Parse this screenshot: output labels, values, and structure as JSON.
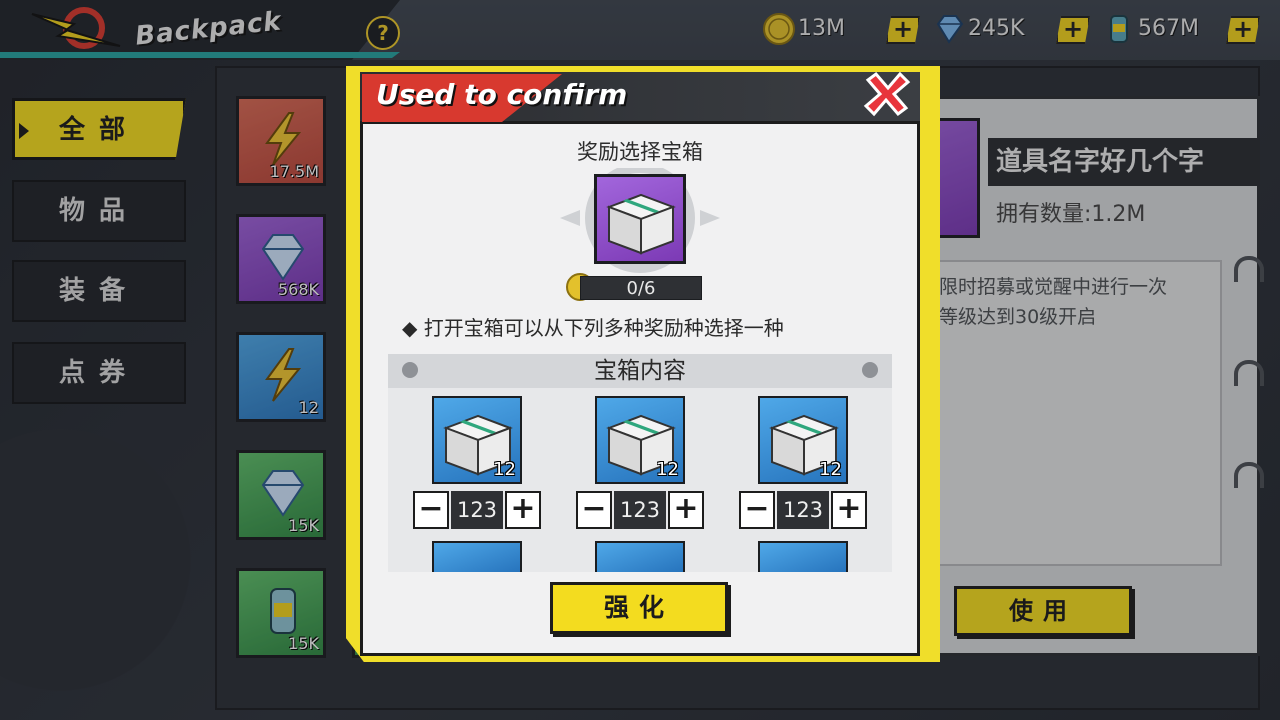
{
  "header": {
    "title": "Backpack",
    "help_label": "?"
  },
  "currencies": [
    {
      "icon": "gold-coin-icon",
      "value": "13M",
      "plus": "+"
    },
    {
      "icon": "diamond-icon",
      "value": "245K",
      "plus": "+"
    },
    {
      "icon": "canister-icon",
      "value": "567M",
      "plus": "+"
    }
  ],
  "tabs": [
    {
      "label": "全部",
      "active": true
    },
    {
      "label": "物品",
      "active": false
    },
    {
      "label": "装备",
      "active": false
    },
    {
      "label": "点券",
      "active": false
    }
  ],
  "inventory": [
    {
      "color": "red",
      "icon": "lightning-icon",
      "count": "17.5M"
    },
    {
      "color": "purple",
      "icon": "diamond-icon",
      "count": "568K"
    },
    {
      "color": "blue",
      "icon": "lightning-icon",
      "count": "12"
    },
    {
      "color": "green",
      "icon": "diamond-icon",
      "count": "15K"
    },
    {
      "color": "green",
      "icon": "canister-icon",
      "count": "15K"
    }
  ],
  "detail": {
    "name": "道具名字好几个字",
    "quantity": "拥有数量:1.2M",
    "description_line1": "在限时招募或觉醒中进行一次",
    "description_line2": "，等级达到30级开启",
    "use_label": "使用"
  },
  "modal": {
    "title": "Used to confirm",
    "chest_title": "奖励选择宝箱",
    "progress": "0/6",
    "hint": "◆ 打开宝箱可以从下列多种奖励种选择一种",
    "content_title": "宝箱内容",
    "rewards": [
      {
        "count": "12",
        "qty": "123",
        "minus": "−",
        "plus": "+"
      },
      {
        "count": "12",
        "qty": "123",
        "minus": "−",
        "plus": "+"
      },
      {
        "count": "12",
        "qty": "123",
        "minus": "−",
        "plus": "+"
      }
    ],
    "confirm_label": "强化"
  },
  "colors": {
    "accent_yellow": "#f3dc1f",
    "header_red": "#d8392f",
    "dark": "#2b2d31"
  }
}
